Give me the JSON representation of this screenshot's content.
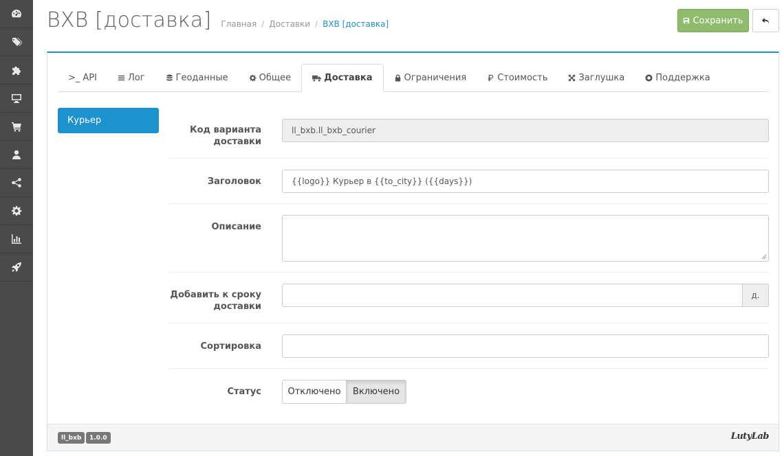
{
  "sidebar": {
    "items": [
      {
        "icon": "dashboard-icon"
      },
      {
        "icon": "tags-icon"
      },
      {
        "icon": "puzzle-icon"
      },
      {
        "icon": "monitor-icon"
      },
      {
        "icon": "cart-icon"
      },
      {
        "icon": "user-icon"
      },
      {
        "icon": "share-icon"
      },
      {
        "icon": "gear-icon"
      },
      {
        "icon": "bar-chart-icon"
      },
      {
        "icon": "rocket-icon"
      }
    ]
  },
  "header": {
    "title": "BXB [доставка]",
    "breadcrumb": [
      "Главная",
      "Доставки",
      "BXB [доставка]"
    ],
    "save_label": "Сохранить"
  },
  "tabs": [
    {
      "label": "API",
      "icon": "terminal-icon",
      "prefix": ">_"
    },
    {
      "label": "Лог",
      "icon": "list-icon"
    },
    {
      "label": "Геоданные",
      "icon": "database-icon"
    },
    {
      "label": "Общее",
      "icon": "gear-icon"
    },
    {
      "label": "Доставка",
      "icon": "truck-icon"
    },
    {
      "label": "Ограничения",
      "icon": "lock-icon"
    },
    {
      "label": "Стоимость",
      "icon": "ruble-icon"
    },
    {
      "label": "Заглушка",
      "icon": "arrows-icon"
    },
    {
      "label": "Поддержка",
      "icon": "lifebuoy-icon"
    }
  ],
  "active_tab": "Доставка",
  "left_nav": {
    "active_item": "Курьер"
  },
  "form": {
    "code": {
      "label": "Код варианта доставки",
      "value": "ll_bxb.ll_bxb_courier"
    },
    "title": {
      "label": "Заголовок",
      "value": "{{logo}} Курьер в {{to_city}} ({{days}})"
    },
    "description": {
      "label": "Описание",
      "value": ""
    },
    "add_days": {
      "label": "Добавить к сроку доставки",
      "value": "",
      "addon": "д."
    },
    "sort": {
      "label": "Сортировка",
      "value": ""
    },
    "status": {
      "label": "Статус",
      "off_label": "Отключено",
      "on_label": "Включено",
      "selected": "Включено"
    }
  },
  "footer": {
    "module_badge": "ll_bxb",
    "version_badge": "1.0.0",
    "logo_text": "LutyLab"
  },
  "colors": {
    "accent": "#1e91cf",
    "save": "#8fbb6c",
    "sidebar": "#4a4a4a"
  }
}
